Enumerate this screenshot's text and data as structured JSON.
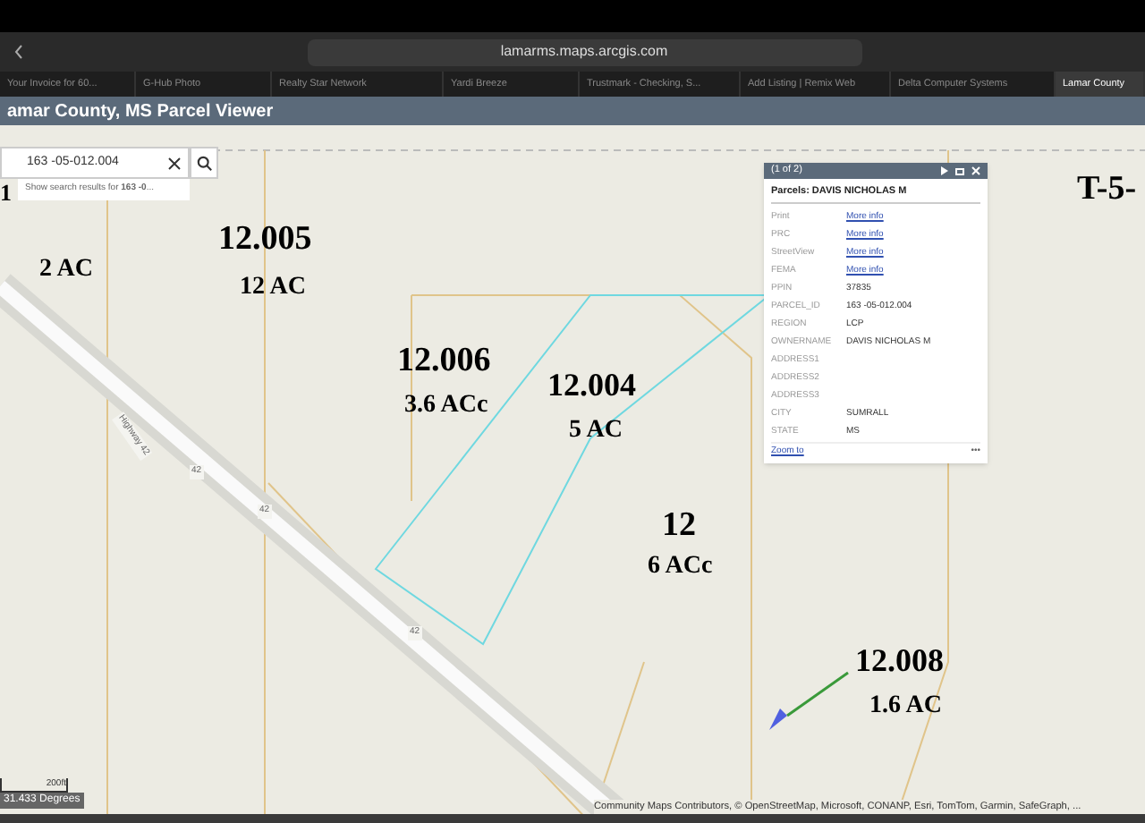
{
  "browser": {
    "url": "lamarms.maps.arcgis.com",
    "tabs": [
      {
        "label": "Your Invoice for 60...",
        "selected": false
      },
      {
        "label": "G-Hub Photo",
        "selected": false
      },
      {
        "label": "Realty Star Network",
        "selected": false
      },
      {
        "label": "Yardi Breeze",
        "selected": false
      },
      {
        "label": "Trustmark - Checking, S...",
        "selected": false
      },
      {
        "label": "Add Listing | Remix Web",
        "selected": false
      },
      {
        "label": "Delta Computer Systems",
        "selected": false
      },
      {
        "label": "Lamar County",
        "selected": true
      }
    ]
  },
  "app": {
    "title": "amar County, MS Parcel Viewer"
  },
  "search": {
    "value": "163 -05-012.004",
    "suggestion": "Show search results for **163 -0**..."
  },
  "map": {
    "labels": [
      {
        "text": "1"
      },
      {
        "text": "12.005"
      },
      {
        "text": "12 AC"
      },
      {
        "text": "2 AC"
      },
      {
        "text": "12.006"
      },
      {
        "text": "3.6 ACc"
      },
      {
        "text": "12.004"
      },
      {
        "text": "5 AC"
      },
      {
        "text": "12"
      },
      {
        "text": "6 ACc"
      },
      {
        "text": "12.008"
      },
      {
        "text": "1.6 AC"
      },
      {
        "text": "T-5-"
      }
    ],
    "road_labels": [
      {
        "text": "Highway 42"
      },
      {
        "text": "42"
      },
      {
        "text": "42"
      },
      {
        "text": "42"
      }
    ],
    "scale": "200ft",
    "coordinates": "31.433 Degrees",
    "attribution": "Community Maps Contributors, © OpenStreetMap, Microsoft, CONANP, Esri, TomTom, Garmin, SafeGraph, ..."
  },
  "popup": {
    "pager": "(1 of 2)",
    "title": "Parcels: DAVIS NICHOLAS M",
    "fields": [
      {
        "name": "Print",
        "value": "More info",
        "kind": "link"
      },
      {
        "name": "PRC",
        "value": "More info",
        "kind": "link"
      },
      {
        "name": "StreetView",
        "value": "More info",
        "kind": "link"
      },
      {
        "name": "FEMA",
        "value": "More info",
        "kind": "link"
      },
      {
        "name": "PPIN",
        "value": "37835",
        "kind": "text"
      },
      {
        "name": "PARCEL_ID",
        "value": "163 -05-012.004",
        "kind": "text"
      },
      {
        "name": "REGION",
        "value": "LCP",
        "kind": "text"
      },
      {
        "name": "OWNERNAME",
        "value": "DAVIS NICHOLAS M",
        "kind": "text"
      },
      {
        "name": "ADDRESS1",
        "kind": "text"
      },
      {
        "name": "ADDRESS2",
        "kind": "text"
      },
      {
        "name": "ADDRESS3",
        "kind": "text"
      },
      {
        "name": "CITY",
        "value": "SUMRALL",
        "kind": "text"
      },
      {
        "name": "STATE",
        "value": "MS",
        "kind": "text"
      }
    ],
    "zoom_link": "Zoom to",
    "more": "•••"
  }
}
